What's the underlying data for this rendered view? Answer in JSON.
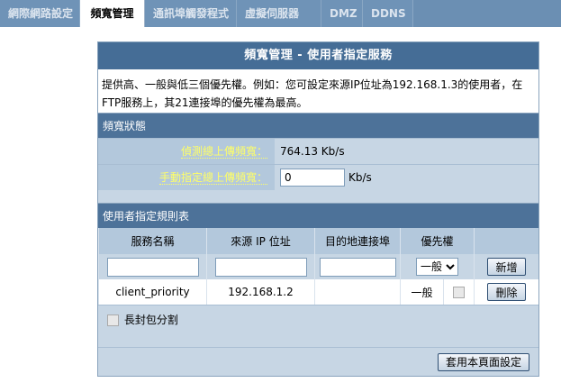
{
  "tabs": [
    {
      "label": "網際網路設定",
      "active": false
    },
    {
      "label": "頻寬管理",
      "active": true
    },
    {
      "label": "通訊埠觸發程式",
      "active": false
    },
    {
      "label": "虛擬伺服器",
      "active": false
    },
    {
      "label": "DMZ",
      "active": false
    },
    {
      "label": "DDNS",
      "active": false
    }
  ],
  "panel": {
    "title": "頻寬管理 - 使用者指定服務",
    "description": "提供高、一般與低三個優先權。例如：您可設定來源IP位址為192.168.1.3的使用者，在FTP服務上，其21連接埠的優先權為最高。"
  },
  "status": {
    "heading": "頻寬狀態",
    "detected_label": "偵測總上傳頻寬：",
    "detected_value": "764.13 Kb/s",
    "manual_label": "手動指定總上傳頻寬：",
    "manual_value": "0",
    "manual_unit": "Kb/s"
  },
  "rules": {
    "heading": "使用者指定規則表",
    "columns": [
      "服務名稱",
      "來源 IP 位址",
      "目的地連接埠",
      "優先權"
    ],
    "priority_selected": "一般",
    "add_button": "新增",
    "rows": [
      {
        "service": "client_priority",
        "source_ip": "192.168.1.2",
        "dest_port": "",
        "priority": "一般",
        "delete_button": "刪除"
      }
    ]
  },
  "fragment_label": "長封包分割",
  "apply_button": "套用本頁面設定"
}
